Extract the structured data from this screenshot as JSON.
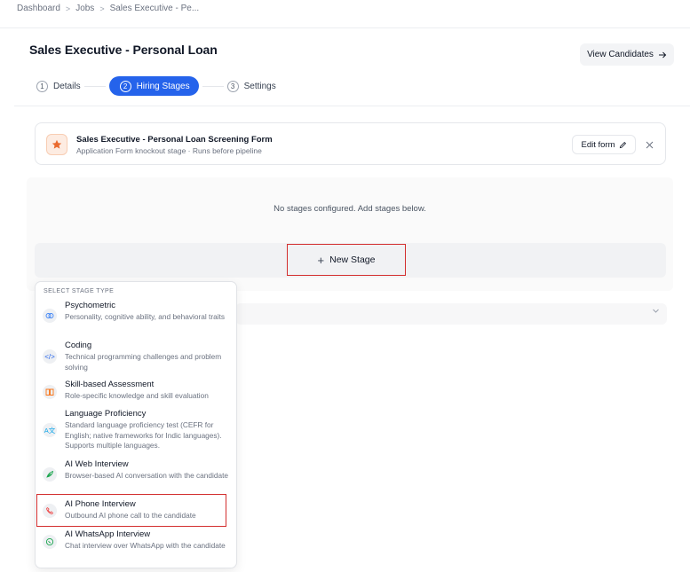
{
  "breadcrumb": {
    "items": [
      "Dashboard",
      "Jobs",
      "Sales Executive - Pe..."
    ],
    "separator": ">"
  },
  "header": {
    "title": "Sales Executive - Personal Loan",
    "view_candidates": "View Candidates",
    "view_candidates_icon": "arrow-right-icon"
  },
  "stepper": {
    "steps": [
      {
        "num": "1",
        "label": "Details",
        "active": false
      },
      {
        "num": "2",
        "label": "Hiring Stages",
        "active": true
      },
      {
        "num": "3",
        "label": "Settings",
        "active": false
      }
    ],
    "active_color": "#2563eb"
  },
  "form_card": {
    "icon": "star-icon",
    "title": "Sales Executive - Personal Loan Screening Form",
    "subtitle": "Application Form knockout stage · Runs before pipeline",
    "edit_label": "Edit form",
    "edit_icon": "pencil-icon",
    "close_icon": "close-icon",
    "accent": "#ea6a2e"
  },
  "stages": {
    "empty_message": "No stages configured. Add stages below.",
    "new_stage_label": "New Stage",
    "new_stage_icon": "plus-icon"
  },
  "dropdown": {
    "header": "SELECT STAGE TYPE",
    "items": [
      {
        "title": "Psychometric",
        "desc": "Personality, cognitive ability, and behavioral traits",
        "icon": "brain-icon",
        "color": "#3b82f6"
      },
      {
        "title": "Coding",
        "desc": "Technical programming challenges and problem solving",
        "icon": "code-icon",
        "color": "#2563eb"
      },
      {
        "title": "Skill-based Assessment",
        "desc": "Role-specific knowledge and skill evaluation",
        "icon": "book-icon",
        "color": "#f97316"
      },
      {
        "title": "Language Proficiency",
        "desc": "Standard language proficiency test (CEFR for English; native frameworks for Indic languages). Supports multiple languages.",
        "icon": "translate-icon",
        "color": "#0ea5e9"
      },
      {
        "title": "AI Web Interview",
        "desc": "Browser-based AI conversation with the candidate",
        "icon": "feather-icon",
        "color": "#16a34a"
      },
      {
        "title": "AI Phone Interview",
        "desc": "Outbound AI phone call to the candidate",
        "icon": "phone-icon",
        "color": "#ef4444"
      },
      {
        "title": "AI WhatsApp Interview",
        "desc": "Chat interview over WhatsApp with the candidate",
        "icon": "whatsapp-icon",
        "color": "#16a34a"
      }
    ]
  },
  "highlight_color": "#d32f2f"
}
